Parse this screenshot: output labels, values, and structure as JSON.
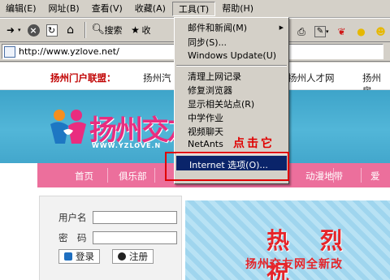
{
  "menubar": {
    "items": [
      "编辑(E)",
      "网址(B)",
      "查看(V)",
      "收藏(A)",
      "工具(T)",
      "帮助(H)"
    ]
  },
  "toolbar": {
    "search_label": "搜索",
    "favorites_label": "收",
    "icons": [
      "back-arrow",
      "forward-arrow",
      "stop",
      "refresh",
      "home",
      "search",
      "favorites",
      "print",
      "edit"
    ]
  },
  "address": {
    "url": "http://www.yzlove.net/"
  },
  "site": {
    "alliance_label": "扬州门户联盟：",
    "alliance_links": [
      "扬州汽",
      "扬州人才网",
      "扬州房"
    ],
    "logo_text": "扬州交友",
    "logo_url": "WWW.YZLOVE.N",
    "nav": [
      "首页",
      "俱乐部",
      "动漫地带",
      "爱"
    ],
    "login": {
      "username_label": "用户名",
      "password_label": "密　码",
      "login_button": "登录",
      "register_button": "注册"
    },
    "promo_big": "热 烈 祝",
    "promo_sub": "扬州交友网全新改"
  },
  "dropdown": {
    "items": [
      {
        "label": "邮件和新闻(M)",
        "submenu": true
      },
      {
        "label": "同步(S)..."
      },
      {
        "label": "Windows Update(U)"
      },
      {
        "label": "清理上网记录"
      },
      {
        "label": "修复浏览器"
      },
      {
        "label": "显示相关站点(R)"
      },
      {
        "label": "中学作业"
      },
      {
        "label": "视频聊天"
      },
      {
        "label": "NetAnts"
      },
      {
        "label": "Internet 选项(O)..."
      }
    ],
    "highlighted": "Internet 选项(O)..."
  },
  "annotation": {
    "text": "点击它",
    "color": "#e00000"
  },
  "colors": {
    "menu_bg": "#d4d0c8",
    "highlight": "#0a246a",
    "nav_pink": "#ec6f9c",
    "banner_blue": "#52b6d8"
  }
}
